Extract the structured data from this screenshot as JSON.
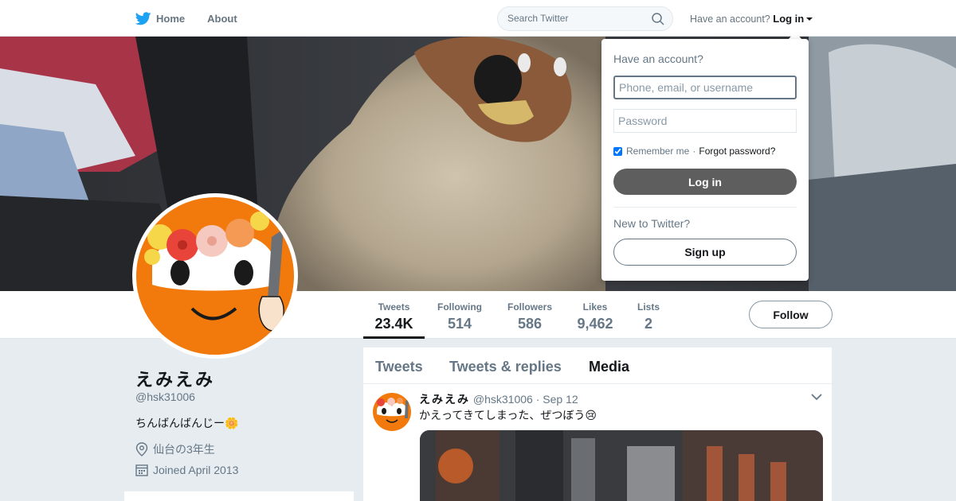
{
  "topnav": {
    "home_label": "Home",
    "about_label": "About",
    "search_placeholder": "Search Twitter",
    "have_account": "Have an account?",
    "login_label": "Log in"
  },
  "profile_nav": {
    "stats": [
      {
        "label": "Tweets",
        "value": "23.4K"
      },
      {
        "label": "Following",
        "value": "514"
      },
      {
        "label": "Followers",
        "value": "586"
      },
      {
        "label": "Likes",
        "value": "9,462"
      },
      {
        "label": "Lists",
        "value": "2"
      }
    ],
    "follow_label": "Follow"
  },
  "profile": {
    "display_name": "えみえみ",
    "handle": "@hsk31006",
    "bio": "ちんばんばんじー🌼",
    "location": "仙台の3年生",
    "joined": "Joined April 2013"
  },
  "timeline": {
    "tabs": [
      "Tweets",
      "Tweets & replies",
      "Media"
    ],
    "active_tab": "Media",
    "tweet": {
      "name": "えみえみ",
      "handle": "@hsk31006",
      "separator": "·",
      "time": "Sep 12",
      "text": "かえってきてしまった、ぜつぼう😢"
    }
  },
  "login_dropdown": {
    "title": "Have an account?",
    "username_placeholder": "Phone, email, or username",
    "password_placeholder": "Password",
    "remember_label": "Remember me",
    "separator": "·",
    "forgot_label": "Forgot password?",
    "login_button": "Log in",
    "new_label": "New to Twitter?",
    "signup_button": "Sign up"
  },
  "colors": {
    "brand_blue": "#1da1f2",
    "avatar_orange": "#f27a0c"
  }
}
